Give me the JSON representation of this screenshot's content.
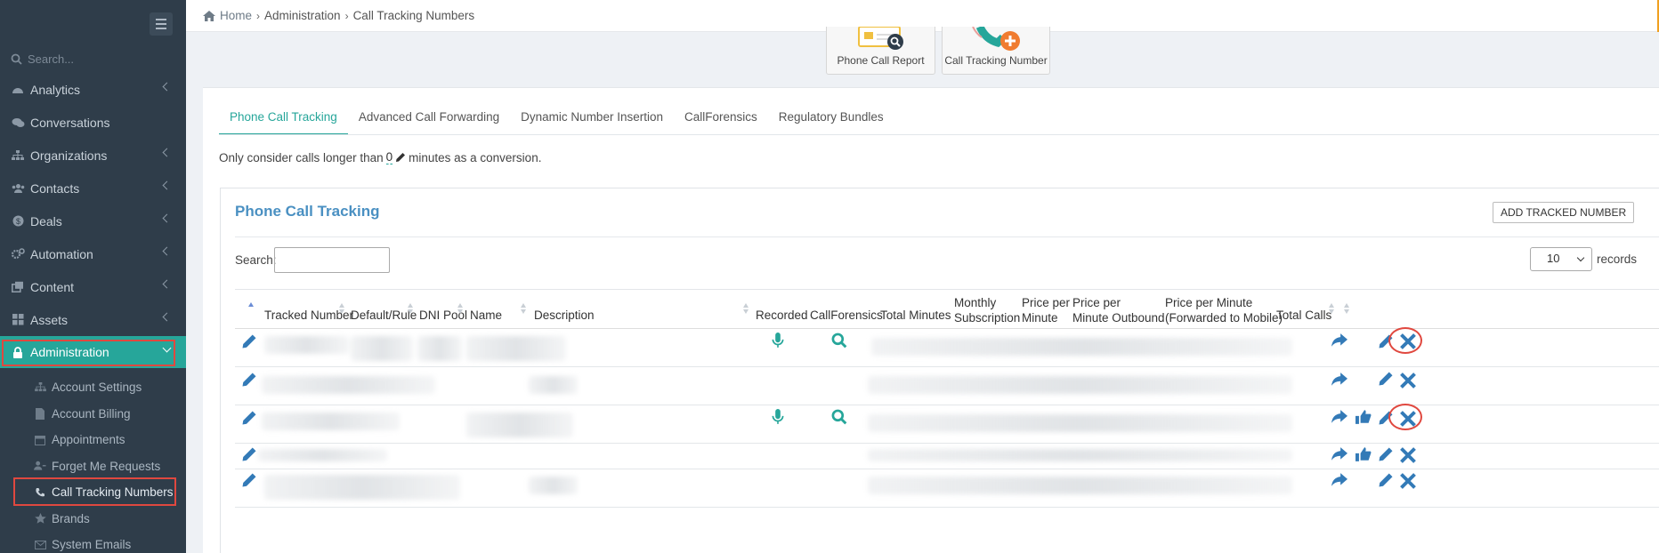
{
  "sidebar": {
    "search_placeholder": "Search...",
    "items": [
      {
        "label": "Analytics",
        "icon": "dashboard-icon"
      },
      {
        "label": "Conversations",
        "icon": "comments-icon"
      },
      {
        "label": "Organizations",
        "icon": "sitemap-icon"
      },
      {
        "label": "Contacts",
        "icon": "users-icon"
      },
      {
        "label": "Deals",
        "icon": "dollar-icon"
      },
      {
        "label": "Automation",
        "icon": "cogs-icon"
      },
      {
        "label": "Content",
        "icon": "clone-icon"
      },
      {
        "label": "Assets",
        "icon": "grid-icon"
      },
      {
        "label": "Administration",
        "icon": "lock-icon"
      }
    ],
    "subitems": [
      {
        "label": "Account Settings",
        "icon": "sitemap-icon"
      },
      {
        "label": "Account Billing",
        "icon": "file-icon"
      },
      {
        "label": "Appointments",
        "icon": "calendar-icon"
      },
      {
        "label": "Forget Me Requests",
        "icon": "user-minus-icon"
      },
      {
        "label": "Call Tracking Numbers",
        "icon": "phone-icon"
      },
      {
        "label": "Brands",
        "icon": "star-icon"
      },
      {
        "label": "System Emails",
        "icon": "envelope-icon"
      }
    ]
  },
  "breadcrumb": {
    "home": "Home",
    "section": "Administration",
    "page": "Call Tracking Numbers"
  },
  "quick_actions": [
    {
      "label": "Phone Call Report"
    },
    {
      "label": "Call Tracking Number"
    }
  ],
  "tabs": [
    "Phone Call Tracking",
    "Advanced Call Forwarding",
    "Dynamic Number Insertion",
    "CallForensics",
    "Regulatory Bundles"
  ],
  "conversion": {
    "prefix": "Only consider calls longer than",
    "value": "0",
    "suffix": "minutes as a conversion."
  },
  "section": {
    "title": "Phone Call Tracking",
    "add_button": "ADD TRACKED NUMBER",
    "search_label": "Search:",
    "records_value": "10",
    "records_label": "records"
  },
  "table": {
    "columns": [
      "Tracked Number",
      "Default/Rule",
      "DNI Pool",
      "Name",
      "Description",
      "Recorded",
      "CallForensics",
      "Total Minutes",
      "Monthly Subscription",
      "Price per Minute",
      "Price per Minute Outbound",
      "Price per Minute (Forwarded to Mobile)",
      "Total Calls"
    ],
    "headers_split": {
      "monthly": [
        "Monthly",
        "Subscription"
      ],
      "ppm": [
        "Price per",
        "Minute"
      ],
      "ppmo": [
        "Price per",
        "Minute Outbound"
      ],
      "ppmf": [
        "Price per Minute",
        "(Forwarded to Mobile)"
      ]
    }
  },
  "colors": {
    "sidebar_bg": "#2f3d4a",
    "accent": "#26a69a",
    "link_blue": "#337ab7",
    "highlight_red": "#e0483f"
  }
}
